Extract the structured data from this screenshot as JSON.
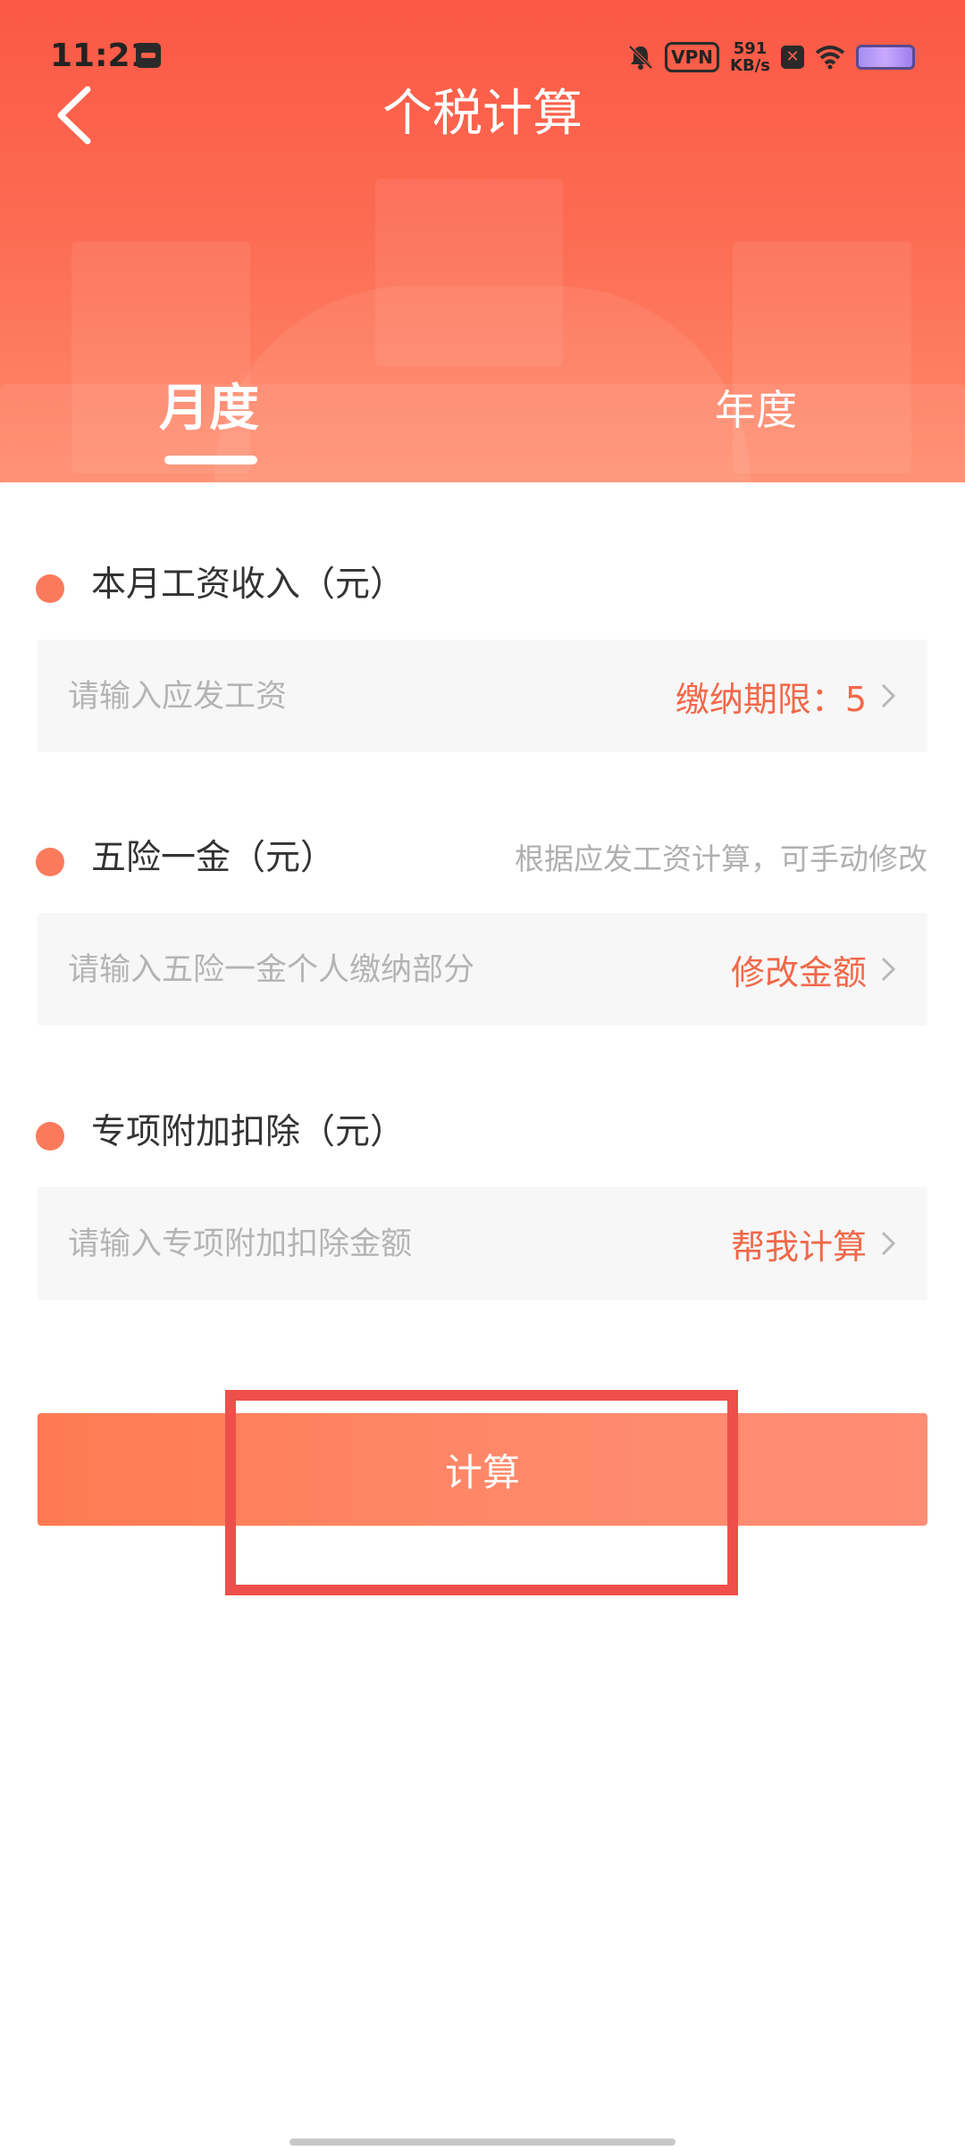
{
  "status_bar": {
    "time": "11:21",
    "vpn": "VPN",
    "speed_value": "591",
    "speed_unit": "KB/s",
    "sim_mark": "✕"
  },
  "header": {
    "title": "个税计算",
    "tabs": [
      {
        "label": "月度",
        "active": true
      },
      {
        "label": "年度",
        "active": false
      }
    ]
  },
  "form": {
    "salary": {
      "label": "本月工资收入（元）",
      "placeholder": "请输入应发工资",
      "action": "缴纳期限：5"
    },
    "insurance": {
      "label": "五险一金（元）",
      "hint": "根据应发工资计算，可手动修改",
      "placeholder": "请输入五险一金个人缴纳部分",
      "action": "修改金额"
    },
    "deduction": {
      "label": "专项附加扣除（元）",
      "placeholder": "请输入专项附加扣除金额",
      "action": "帮我计算"
    }
  },
  "calculate_button": "计算",
  "colors": {
    "header_top": "#fb5845",
    "accent": "#f2684a",
    "button": "#ff8a6c",
    "highlight": "#ee4f4b"
  }
}
